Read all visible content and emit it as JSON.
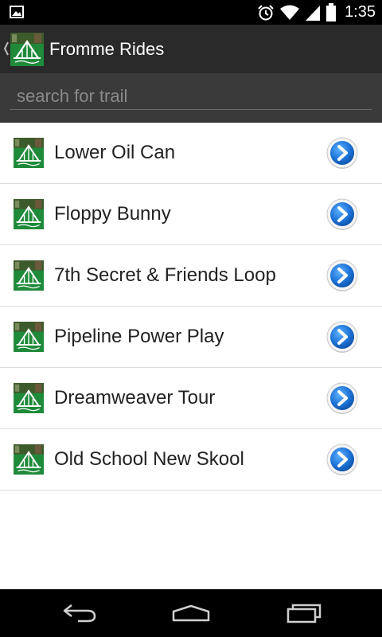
{
  "status_bar": {
    "time": "1:35",
    "icons": [
      "image-icon",
      "alarm-icon",
      "wifi-icon",
      "signal-icon",
      "battery-icon"
    ]
  },
  "action_bar": {
    "title": "Fromme Rides",
    "icons": [
      "up-caret-icon",
      "app-logo-icon"
    ]
  },
  "search": {
    "placeholder": "search for trail",
    "value": ""
  },
  "trails": [
    {
      "name": "Lower Oil Can"
    },
    {
      "name": "Floppy Bunny"
    },
    {
      "name": "7th Secret & Friends Loop"
    },
    {
      "name": "Pipeline Power Play"
    },
    {
      "name": "Dreamweaver Tour"
    },
    {
      "name": "Old School New Skool"
    }
  ],
  "nav_bar": {
    "icons": [
      "back-icon",
      "home-icon",
      "recent-apps-icon"
    ]
  },
  "colors": {
    "action_bar_bg": "#2a2a2a",
    "search_bg": "#3a3a3a",
    "accent_blue": "#1e74d8",
    "logo_green": "#1f8a3a"
  }
}
